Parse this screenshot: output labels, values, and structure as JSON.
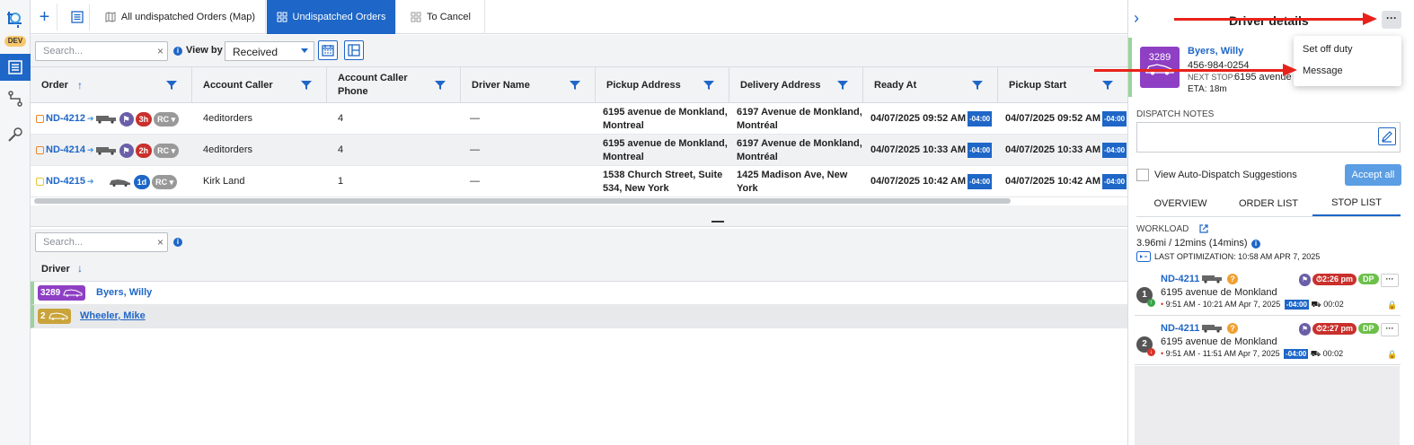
{
  "app": {
    "env_badge": "DEV"
  },
  "tabs": [
    {
      "label": "All undispatched Orders (Map)"
    },
    {
      "label": "Undispatched Orders"
    },
    {
      "label": "To Cancel"
    }
  ],
  "filters": {
    "search_placeholder": "Search...",
    "view_by_label": "View by",
    "view_by_value": "Received"
  },
  "orders_table": {
    "columns": [
      "Order",
      "Account Caller",
      "Account Caller Phone",
      "Driver Name",
      "Pickup Address",
      "Delivery Address",
      "Ready At",
      "Pickup Start"
    ],
    "column_two_line": {
      "phone_line1": "Account Caller",
      "phone_line2": "Phone"
    },
    "rows": [
      {
        "order": "ND-4212",
        "age": "3h",
        "age_color": "#c9302c",
        "rc": "RC",
        "account": "4editorders",
        "phone": "4",
        "driver": "—",
        "pickup1": "6195 avenue de Monkland,",
        "pickup2": "Montreal",
        "delivery1": "6197 Avenue de Monkland,",
        "delivery2": "Montréal",
        "ready": "04/07/2025 09:52 AM",
        "ready_tz": "-04:00",
        "pickup_start": "04/07/2025 09:52 AM",
        "pickup_tz": "-04:00"
      },
      {
        "order": "ND-4214",
        "age": "2h",
        "age_color": "#c9302c",
        "rc": "RC",
        "account": "4editorders",
        "phone": "4",
        "driver": "—",
        "pickup1": "6195 avenue de Monkland,",
        "pickup2": "Montreal",
        "delivery1": "6197 Avenue de Monkland,",
        "delivery2": "Montréal",
        "ready": "04/07/2025 10:33 AM",
        "ready_tz": "-04:00",
        "pickup_start": "04/07/2025 10:33 AM",
        "pickup_tz": "-04:00"
      },
      {
        "order": "ND-4215",
        "age": "1d",
        "age_color": "#1e66c7",
        "rc": "RC",
        "account": "Kirk Land",
        "phone": "1",
        "driver": "—",
        "pickup1": "1538 Church Street, Suite",
        "pickup2": "534, New York",
        "delivery1": "1425 Madison Ave, New",
        "delivery2": "York",
        "ready": "04/07/2025 10:42 AM",
        "ready_tz": "-04:00",
        "pickup_start": "04/07/2025 10:42 AM",
        "pickup_tz": "-04:00"
      }
    ]
  },
  "drivers_table": {
    "search_placeholder": "Search...",
    "column": "Driver",
    "rows": [
      {
        "number": "3289",
        "name": "Byers, Willy",
        "color": "#8e3fc4"
      },
      {
        "number": "2",
        "name": "Wheeler, Mike",
        "color": "#c9a43a"
      }
    ]
  },
  "driver_details": {
    "title": "Driver details",
    "number": "3289",
    "name": "Byers, Willy",
    "phone": "456-984-0254",
    "next_stop_label": "NEXT STOP:",
    "next_stop_value": "6195 avenue de",
    "eta": "ETA: 18m",
    "menu": {
      "set_off_duty": "Set off duty",
      "message": "Message"
    },
    "dispatch_notes_label": "DISPATCH NOTES",
    "auto_dispatch_label": "View Auto-Dispatch Suggestions",
    "accept_all": "Accept all",
    "tabs": [
      "OVERVIEW",
      "ORDER LIST",
      "STOP LIST"
    ],
    "workload_label": "WORKLOAD",
    "workload_value": "3.96mi / 12mins (14mins)",
    "last_optimization": "LAST OPTIMIZATION: 10:58 AM APR 7, 2025",
    "stops": [
      {
        "seq": "1",
        "order": "ND-4211",
        "time": "2:26 pm",
        "tag": "DP",
        "address": "6195 avenue de Monkland",
        "window": "9:51 AM - 10:21 AM Apr 7, 2025",
        "tz": "-04:00",
        "duration": "00:02"
      },
      {
        "seq": "2",
        "order": "ND-4211",
        "time": "2:27 pm",
        "tag": "DP",
        "address": "6195 avenue de Monkland",
        "window": "9:51 AM - 11:51 AM Apr 7, 2025",
        "tz": "-04:00",
        "duration": "00:02"
      }
    ]
  },
  "colors": {
    "accent": "#1e66c7",
    "annotation_arrow": "#e8221b"
  }
}
